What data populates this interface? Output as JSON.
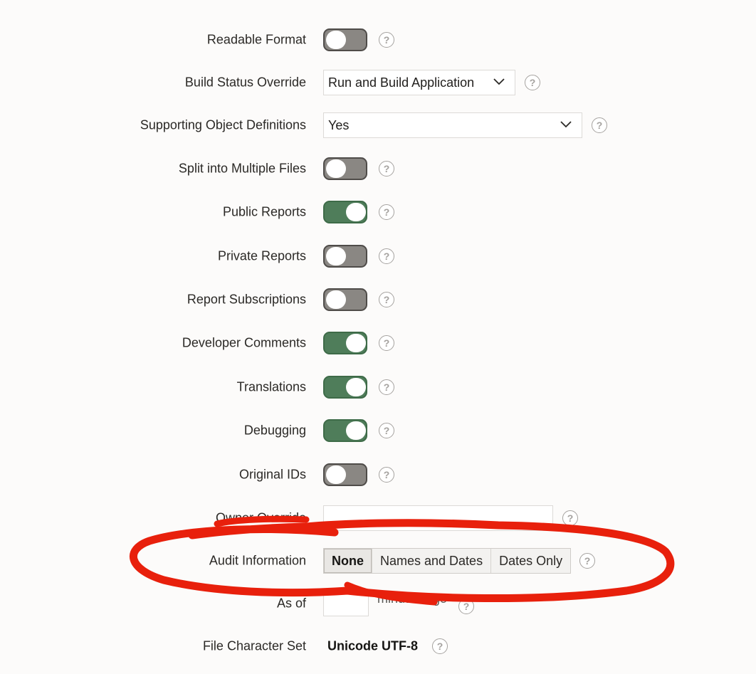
{
  "rows": {
    "readable_format": {
      "label": "Readable Format",
      "on": false
    },
    "build_status_override": {
      "label": "Build Status Override",
      "value": "Run and Build Application"
    },
    "supporting_object_definitions": {
      "label": "Supporting Object Definitions",
      "value": "Yes"
    },
    "split_into_multiple_files": {
      "label": "Split into Multiple Files",
      "on": false
    },
    "public_reports": {
      "label": "Public Reports",
      "on": true
    },
    "private_reports": {
      "label": "Private Reports",
      "on": false
    },
    "report_subscriptions": {
      "label": "Report Subscriptions",
      "on": false
    },
    "developer_comments": {
      "label": "Developer Comments",
      "on": true
    },
    "translations": {
      "label": "Translations",
      "on": true
    },
    "debugging": {
      "label": "Debugging",
      "on": true
    },
    "original_ids": {
      "label": "Original IDs",
      "on": false
    },
    "owner_override": {
      "label": "Owner Override",
      "value": ""
    },
    "audit_information": {
      "label": "Audit Information",
      "options": [
        "None",
        "Names and Dates",
        "Dates Only"
      ],
      "selected": "None"
    },
    "as_of": {
      "label": "As of",
      "value": "",
      "suffix": "minutes ago"
    },
    "file_character_set": {
      "label": "File Character Set",
      "value": "Unicode UTF-8"
    }
  },
  "help_glyph": "?",
  "icons": {
    "help": "question-circle-icon",
    "select": "chevron-down-icon"
  },
  "colors": {
    "toggle_on": "#4f7d5a",
    "toggle_off": "#8a8783",
    "annotation": "#e8200c"
  }
}
